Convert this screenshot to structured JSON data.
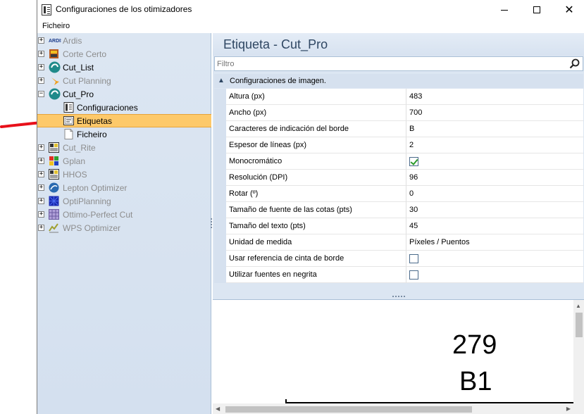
{
  "window": {
    "title": "Configuraciones de los otimizadores",
    "minimize_glyph": "",
    "maximize_glyph": "",
    "close_glyph": "✕"
  },
  "menu": {
    "items": [
      {
        "label": "Ficheiro"
      }
    ]
  },
  "tree": {
    "items": [
      {
        "label": "Ardis",
        "enabled": false,
        "icon": "ardis-logo-icon",
        "expander": "+"
      },
      {
        "label": "Corte Certo",
        "enabled": false,
        "icon": "corte-certo-icon",
        "expander": "+"
      },
      {
        "label": "Cut_List",
        "enabled": true,
        "icon": "cut-list-icon",
        "expander": "+"
      },
      {
        "label": "Cut Planning",
        "enabled": false,
        "icon": "cut-planning-icon",
        "expander": "+"
      },
      {
        "label": "Cut_Pro",
        "enabled": true,
        "icon": "cut-pro-icon",
        "expander": "−"
      },
      {
        "label": "Configuraciones",
        "enabled": true,
        "icon": "settings-document-icon",
        "child": true
      },
      {
        "label": "Etiquetas",
        "enabled": true,
        "icon": "label-icon",
        "child": true,
        "selected": true
      },
      {
        "label": "Ficheiro",
        "enabled": true,
        "icon": "file-icon",
        "child": true
      },
      {
        "label": "Cut_Rite",
        "enabled": false,
        "icon": "cut-rite-icon",
        "expander": "+"
      },
      {
        "label": "Gplan",
        "enabled": false,
        "icon": "gplan-icon",
        "expander": "+"
      },
      {
        "label": "HHOS",
        "enabled": false,
        "icon": "hhos-icon",
        "expander": "+"
      },
      {
        "label": "Lepton Optimizer",
        "enabled": false,
        "icon": "lepton-icon",
        "expander": "+"
      },
      {
        "label": "OptiPlanning",
        "enabled": false,
        "icon": "optiplanning-icon",
        "expander": "+"
      },
      {
        "label": "Ottimo-Perfect Cut",
        "enabled": false,
        "icon": "ottimo-icon",
        "expander": "+"
      },
      {
        "label": "WPS Optimizer",
        "enabled": false,
        "icon": "wps-icon",
        "expander": "+"
      }
    ]
  },
  "panel": {
    "title": "Etiqueta - Cut_Pro",
    "filter_placeholder": "Filtro",
    "category": "Configuraciones de imagen.",
    "properties": [
      {
        "name": "Altura (px)",
        "value": "483"
      },
      {
        "name": "Ancho (px)",
        "value": "700"
      },
      {
        "name": "Caracteres de indicación del borde",
        "value": "B"
      },
      {
        "name": "Espesor de líneas (px)",
        "value": "2"
      },
      {
        "name": "Monocromático",
        "checkbox": true,
        "checked": true
      },
      {
        "name": "Resolución (DPI)",
        "value": "96"
      },
      {
        "name": "Rotar (º)",
        "value": "0"
      },
      {
        "name": "Tamaño de fuente de las cotas (pts)",
        "value": "30"
      },
      {
        "name": "Tamaño del texto (pts)",
        "value": "45"
      },
      {
        "name": "Unidad de medida",
        "value": "Píxeles / Puentos"
      },
      {
        "name": "Usar referencia de cinta de borde",
        "checkbox": true,
        "checked": false
      },
      {
        "name": "Utilizar fuentes en negrita",
        "checkbox": true,
        "checked": false
      }
    ]
  },
  "preview": {
    "dimension_text": "279",
    "edge_code_text": "B1"
  },
  "colors": {
    "tree_background": "#dce6f2",
    "selected_row": "#fdc96a",
    "panel_title": "#2f4763",
    "annotation_arrow": "#e8101a"
  }
}
